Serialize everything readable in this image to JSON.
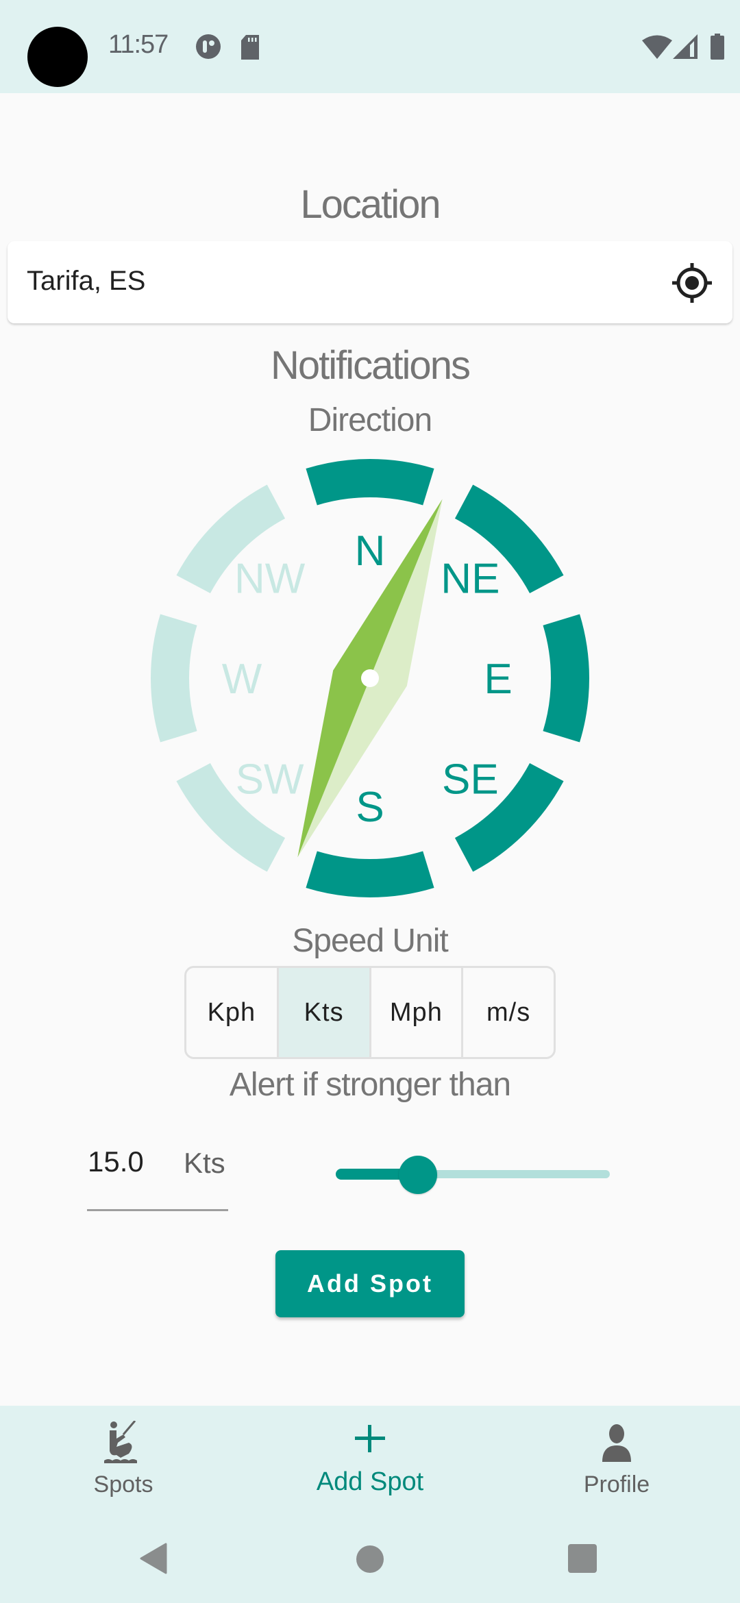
{
  "status_bar": {
    "time": "11:57",
    "left_icons": [
      "pinwheel-icon",
      "sd-card-icon"
    ],
    "right_icons": [
      "wifi-icon",
      "cell-signal-icon",
      "battery-icon"
    ]
  },
  "location": {
    "title": "Location",
    "value": "Tarifa, ES",
    "gps_icon": "my-location-icon"
  },
  "notifications": {
    "title": "Notifications",
    "direction_label": "Direction",
    "compass": {
      "directions": [
        {
          "label": "N",
          "selected": true
        },
        {
          "label": "NE",
          "selected": true
        },
        {
          "label": "E",
          "selected": true
        },
        {
          "label": "SE",
          "selected": true
        },
        {
          "label": "S",
          "selected": true
        },
        {
          "label": "SW",
          "selected": false
        },
        {
          "label": "W",
          "selected": false
        },
        {
          "label": "NW",
          "selected": false
        }
      ],
      "needle_heading_deg": 22,
      "active_color": "#009688",
      "inactive_color": "#c8e8e3",
      "needle_dark": "#8bc34a",
      "needle_light": "#dcedc8"
    },
    "speed_unit_label": "Speed Unit",
    "speed_units": [
      {
        "label": "Kph",
        "selected": false
      },
      {
        "label": "Kts",
        "selected": true
      },
      {
        "label": "Mph",
        "selected": false
      },
      {
        "label": "m/s",
        "selected": false
      }
    ],
    "alert_label": "Alert if stronger than",
    "alert_value": "15.0",
    "alert_unit": "Kts",
    "slider_fraction": 0.3
  },
  "add_spot_button": "Add Spot",
  "bottom_nav": [
    {
      "label": "Spots",
      "icon": "kitesurfing-icon",
      "active": false
    },
    {
      "label": "Add Spot",
      "icon": "plus-icon",
      "active": true
    },
    {
      "label": "Profile",
      "icon": "person-icon",
      "active": false
    }
  ],
  "system_nav": [
    "back-icon",
    "home-icon",
    "recents-icon"
  ],
  "colors": {
    "primary": "#009688",
    "primary_light": "#b2dfdb",
    "bar_background": "#e0f2f1"
  }
}
